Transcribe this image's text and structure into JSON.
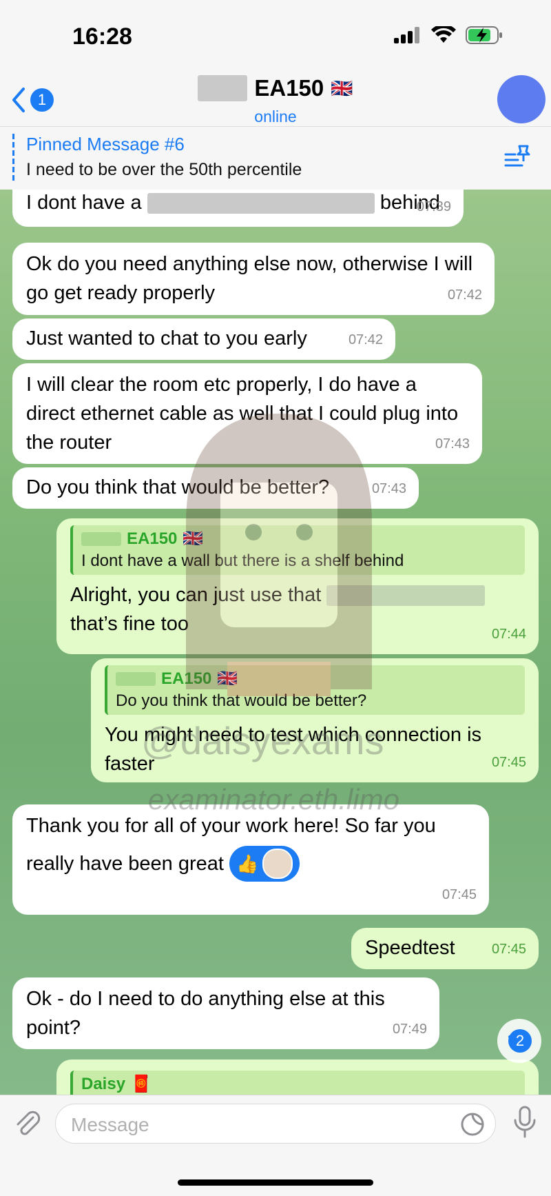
{
  "status_bar": {
    "time": "16:28"
  },
  "header": {
    "back_badge": "1",
    "title": "EA150",
    "flag": "🇬🇧",
    "status": "online"
  },
  "pinned": {
    "title": "Pinned Message #6",
    "text": "I need to be over the 50th percentile"
  },
  "messages": [
    {
      "dir": "in",
      "pre": "I dont have a",
      "post": "behind",
      "time": "07:39"
    },
    {
      "dir": "in",
      "text": "Ok do you need anything else now, otherwise I will go get ready properly",
      "time": "07:42"
    },
    {
      "dir": "in",
      "text": "Just wanted to chat to you early",
      "time": "07:42"
    },
    {
      "dir": "in",
      "text": "I will clear the room etc properly, I do have a direct ethernet cable as well that I could plug into the router",
      "time": "07:43"
    },
    {
      "dir": "in",
      "text": "Do you think that would be better?",
      "time": "07:43"
    },
    {
      "dir": "out",
      "reply_name": "EA150",
      "reply_flag": "🇬🇧",
      "reply_text": "I dont have a wall but there is a shelf behind",
      "pre": "Alright, you can just use that",
      "post": "that’s fine too",
      "time": "07:44"
    },
    {
      "dir": "out",
      "reply_name": "EA150",
      "reply_flag": "🇬🇧",
      "reply_text": "Do you think that would be better?",
      "text": "You might need to test which connection is faster",
      "time": "07:45"
    },
    {
      "dir": "in",
      "text": "Thank you for all of your work here! So far you really have been great",
      "reaction": "👍",
      "time": "07:45"
    },
    {
      "dir": "out",
      "text": "Speedtest",
      "time": "07:45"
    },
    {
      "dir": "in",
      "text": "Ok - do I need to do anything else at this point?",
      "time": "07:49"
    },
    {
      "dir": "out",
      "reply_name": "Daisy",
      "reply_flag": "🧧"
    }
  ],
  "scroll_badge": "2",
  "composer": {
    "placeholder": "Message"
  },
  "watermark": {
    "handle": "@daisyexams",
    "site": "examinator.eth.limo"
  },
  "colors": {
    "accent": "#1b7cf4",
    "incoming": "#ffffff",
    "outgoing": "#e2fbc9",
    "reply_name": "#2aa52a"
  }
}
